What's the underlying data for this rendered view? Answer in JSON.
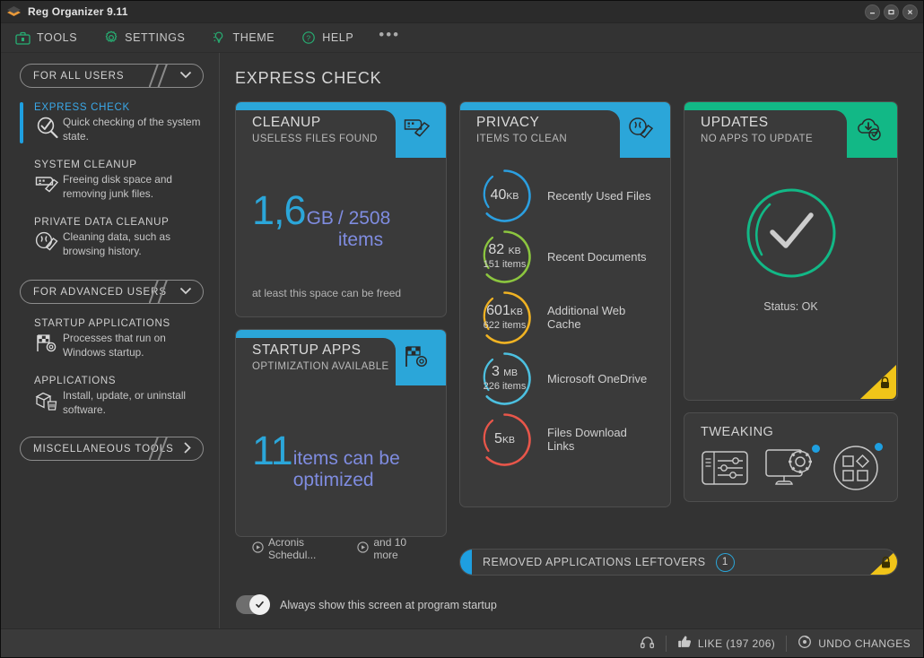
{
  "window": {
    "title": "Reg Organizer 9.11",
    "controls": {
      "minimize": "–",
      "maximize": "▭",
      "close": "✕"
    }
  },
  "toolbar": {
    "items": [
      {
        "label": "TOOLS",
        "icon": "toolbox-icon"
      },
      {
        "label": "SETTINGS",
        "icon": "gear-icon"
      },
      {
        "label": "THEME",
        "icon": "lightbulb-icon"
      },
      {
        "label": "HELP",
        "icon": "question-circle-icon"
      }
    ],
    "overflow": "•••"
  },
  "sidebar": {
    "group_all": "FOR ALL USERS",
    "group_advanced": "FOR ADVANCED USERS",
    "group_misc": "MISCELLANEOUS TOOLS",
    "items": [
      {
        "title": "EXPRESS CHECK",
        "desc": "Quick checking of the system state.",
        "icon": "magnifier-check-icon",
        "active": true
      },
      {
        "title": "SYSTEM CLEANUP",
        "desc": "Freeing disk space and removing junk files.",
        "icon": "broom-disk-icon",
        "active": false
      },
      {
        "title": "PRIVATE DATA CLEANUP",
        "desc": "Cleaning data, such as browsing history.",
        "icon": "broom-privacy-icon",
        "active": false
      },
      {
        "title": "STARTUP APPLICATIONS",
        "desc": "Processes that run on Windows startup.",
        "icon": "flag-gear-icon",
        "active": false
      },
      {
        "title": "APPLICATIONS",
        "desc": "Install, update, or uninstall software.",
        "icon": "box-trash-icon",
        "active": false
      }
    ]
  },
  "main": {
    "page_title": "EXPRESS CHECK",
    "cleanup": {
      "title": "CLEANUP",
      "subtitle": "USELESS FILES FOUND",
      "icon": "broom-disk-icon",
      "value": "1,6",
      "unit": "GB",
      "rest": "/ 2508 items",
      "note": "at least this space can be freed",
      "accent": "#2ba6d9"
    },
    "startup": {
      "title": "STARTUP APPS",
      "subtitle": "OPTIMIZATION AVAILABLE",
      "icon": "flag-gear-icon",
      "value": "11",
      "rest": "items can be optimized",
      "foot_1": "Acronis Schedul...",
      "foot_2": "and 10 more",
      "accent": "#2ba6d9"
    },
    "privacy": {
      "title": "PRIVACY",
      "subtitle": "ITEMS TO CLEAN",
      "icon": "broom-privacy-icon",
      "accent": "#2ba6d9",
      "rows": [
        {
          "value": "40",
          "unit": "KB",
          "items": "",
          "label": "Recently Used Files",
          "color": "#2b9fe0"
        },
        {
          "value": "82",
          "unit": "KB",
          "items": "151 items",
          "label": "Recent Documents",
          "color": "#8cc63f"
        },
        {
          "value": "601",
          "unit": "KB",
          "items": "622 items",
          "label": "Additional Web Cache",
          "color": "#f0b323"
        },
        {
          "value": "3",
          "unit": "MB",
          "items": "226 items",
          "label": "Microsoft OneDrive",
          "color": "#4cc0e0"
        },
        {
          "value": "5",
          "unit": "KB",
          "items": "",
          "label": "Files Download Links",
          "color": "#e8564a"
        }
      ]
    },
    "updates": {
      "title": "UPDATES",
      "subtitle": "NO APPS TO UPDATE",
      "icon": "cloud-download-check-icon",
      "status": "Status: OK",
      "accent": "#12b886",
      "lock_icon": "lock-icon"
    },
    "tweaking": {
      "title": "TWEAKING",
      "icons": [
        "sliders-panel-icon",
        "monitor-gear-icon",
        "shapes-circle-icon"
      ],
      "dot_color": "#1e9fe0"
    },
    "leftovers": {
      "label": "REMOVED APPLICATIONS LEFTOVERS",
      "count": "1",
      "lock_icon": "lock-icon"
    },
    "startup_toggle": {
      "label": "Always show this screen at program startup",
      "checked": true
    }
  },
  "statusbar": {
    "headset_icon": "headset-icon",
    "like_label": "LIKE (197 206)",
    "like_icon": "thumbs-up-icon",
    "undo_label": "UNDO CHANGES",
    "undo_icon": "undo-target-icon"
  }
}
